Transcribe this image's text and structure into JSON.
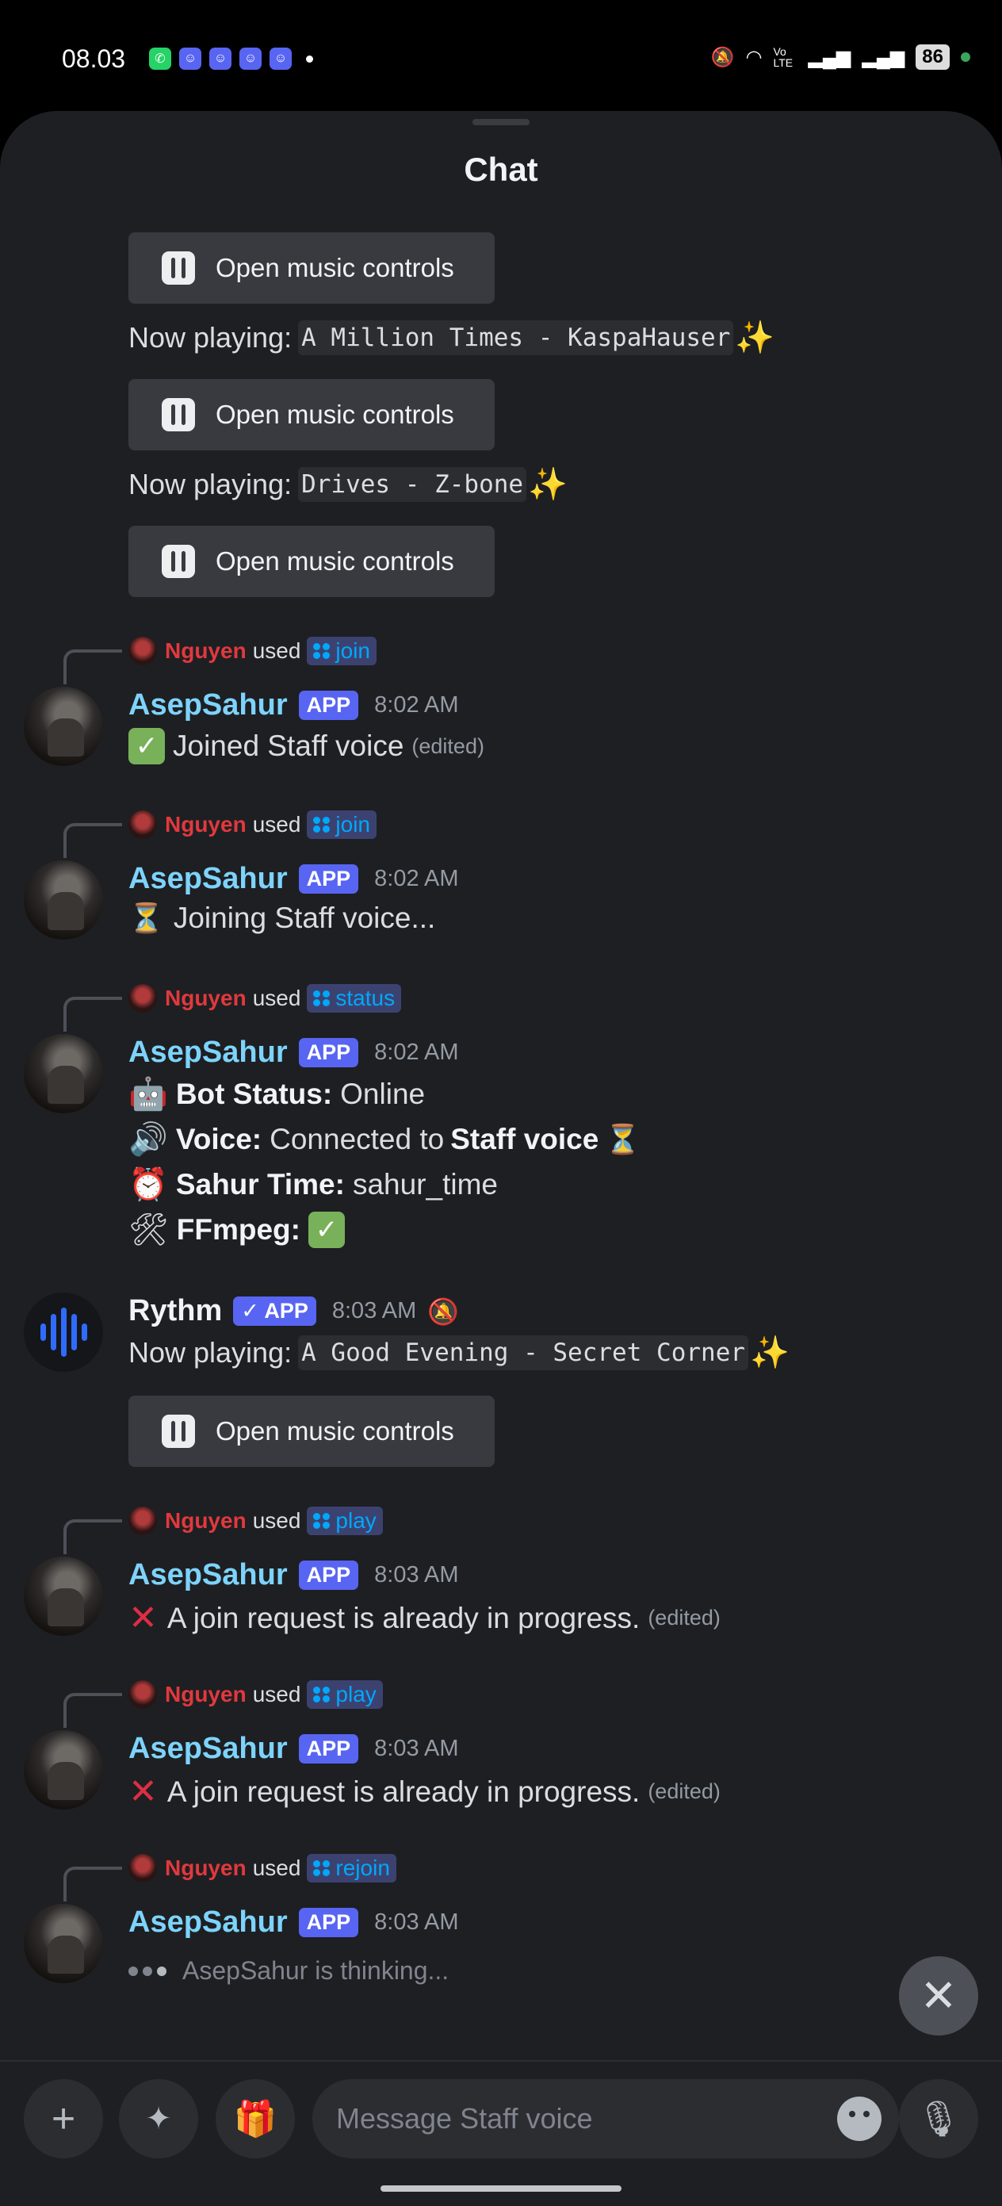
{
  "status_bar": {
    "time": "08.03",
    "battery": "86",
    "notification_icons": [
      "whatsapp-icon",
      "discord-icon",
      "discord-icon",
      "discord-icon",
      "discord-icon"
    ],
    "network_label": "Vo LTE"
  },
  "header": {
    "title": "Chat"
  },
  "music_button_label": "Open music controls",
  "now_playing_prefix": "Now playing:",
  "top_feed": {
    "track_1": "A Million Times - KaspaHauser",
    "track_2": "Drives - Z-bone"
  },
  "messages": [
    {
      "reply_user": "Nguyen",
      "used": "used",
      "command": "join",
      "author": "AsepSahur",
      "badge": "APP",
      "time": "8:02 AM",
      "text": "Joined Staff voice",
      "edited": "(edited)"
    },
    {
      "reply_user": "Nguyen",
      "used": "used",
      "command": "join",
      "author": "AsepSahur",
      "badge": "APP",
      "time": "8:02 AM",
      "text": "Joining Staff voice..."
    },
    {
      "reply_user": "Nguyen",
      "used": "used",
      "command": "status",
      "author": "AsepSahur",
      "badge": "APP",
      "time": "8:02 AM",
      "status_lines": {
        "bot_label": "Bot Status:",
        "bot_value": "Online",
        "voice_label": "Voice:",
        "voice_pre": "Connected to",
        "voice_channel": "Staff voice",
        "sahur_label": "Sahur Time:",
        "sahur_value": "sahur_time",
        "ffmpeg_label": "FFmpeg:"
      }
    },
    {
      "author": "Rythm",
      "badge": "✓ APP",
      "time": "8:03 AM",
      "track": "A Good Evening - Secret Corner"
    },
    {
      "reply_user": "Nguyen",
      "used": "used",
      "command": "play",
      "author": "AsepSahur",
      "badge": "APP",
      "time": "8:03 AM",
      "text": "A join request is already in progress.",
      "edited": "(edited)"
    },
    {
      "reply_user": "Nguyen",
      "used": "used",
      "command": "play",
      "author": "AsepSahur",
      "badge": "APP",
      "time": "8:03 AM",
      "text": "A join request is already in progress.",
      "edited": "(edited)"
    },
    {
      "reply_user": "Nguyen",
      "used": "used",
      "command": "rejoin",
      "author": "AsepSahur",
      "badge": "APP",
      "time": "8:03 AM",
      "thinking": "AsepSahur is thinking..."
    }
  ],
  "composer": {
    "placeholder": "Message Staff voice"
  },
  "colors": {
    "accent": "#5865f2",
    "username": "#7dd3fc",
    "reply_user": "#e0393e",
    "background": "#1e1f22"
  }
}
